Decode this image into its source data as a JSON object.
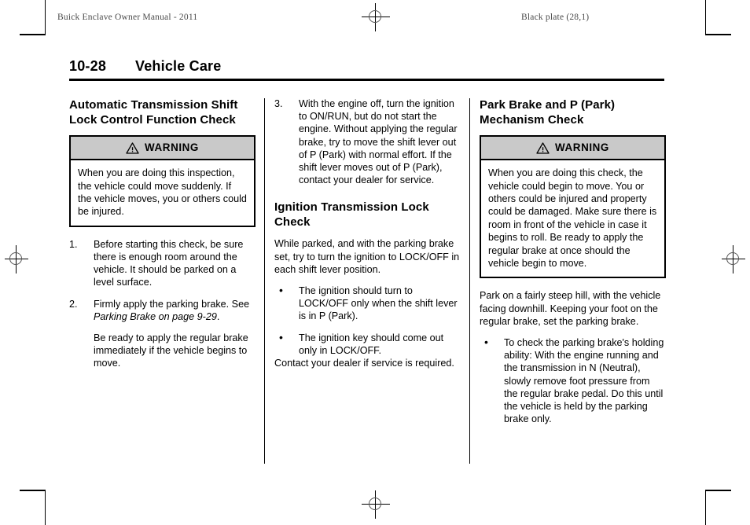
{
  "header": {
    "doc_title": "Buick Enclave Owner Manual - 2011",
    "plate_info": "Black plate (28,1)"
  },
  "page_title": {
    "number": "10-28",
    "section": "Vehicle Care"
  },
  "warning_label": "WARNING",
  "columns": {
    "col1": {
      "heading": "Automatic Transmission Shift Lock Control Function Check",
      "warning": {
        "label": "WARNING",
        "body": "When you are doing this inspection, the vehicle could move suddenly. If the vehicle moves, you or others could be injured."
      },
      "steps": [
        {
          "marker": "1.",
          "paras": [
            "Before starting this check, be sure there is enough room around the vehicle. It should be parked on a level surface."
          ]
        },
        {
          "marker": "2.",
          "paras": [
            "Firmly apply the parking brake. See ",
            "Be ready to apply the regular brake immediately if the vehicle begins to move."
          ],
          "reference": "Parking Brake on page 9-29",
          "reference_tail": "."
        }
      ]
    },
    "col2": {
      "step3": {
        "marker": "3.",
        "text": "With the engine off, turn the ignition to ON/RUN, but do not start the engine. Without applying the regular brake, try to move the shift lever out of P (Park) with normal effort. If the shift lever moves out of P (Park), contact your dealer for service."
      },
      "heading": "Ignition Transmission Lock Check",
      "intro": "While parked, and with the parking brake set, try to turn the ignition to LOCK/OFF in each shift lever position.",
      "bullets": [
        "The ignition should turn to LOCK/OFF only when the shift lever is in P (Park).",
        "The ignition key should come out only in LOCK/OFF."
      ],
      "closing": "Contact your dealer if service is required."
    },
    "col3": {
      "heading": "Park Brake and P (Park) Mechanism Check",
      "warning": {
        "label": "WARNING",
        "body": "When you are doing this check, the vehicle could begin to move. You or others could be injured and property could be damaged. Make sure there is room in front of the vehicle in case it begins to roll. Be ready to apply the regular brake at once should the vehicle begin to move."
      },
      "intro": "Park on a fairly steep hill, with the vehicle facing downhill. Keeping your foot on the regular brake, set the parking brake.",
      "bullets": [
        "To check the parking brake's holding ability: With the engine running and the transmission in N (Neutral), slowly remove foot pressure from the regular brake pedal. Do this until the vehicle is held by the parking brake only."
      ]
    }
  },
  "bullet_glyph": "•",
  "colors": {
    "warning_header_bg": "#c9c9c9",
    "rule": "#000000",
    "running_head_text": "#4a4a4a"
  }
}
